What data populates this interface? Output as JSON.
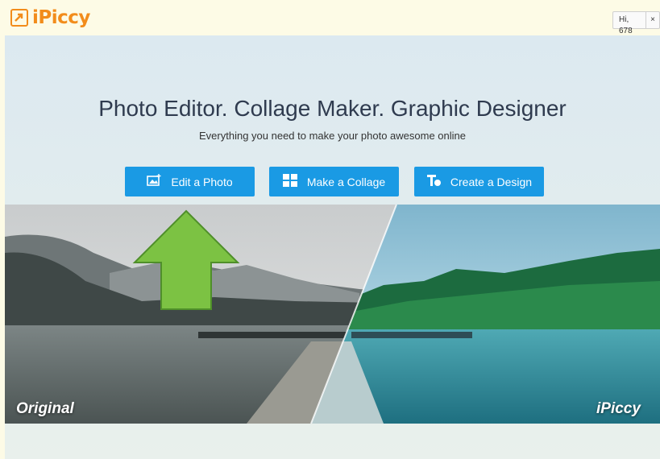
{
  "app": {
    "logo_text": "iPiccy",
    "brand_color": "#f28c1b",
    "accent_color": "#1a9ae4"
  },
  "header": {
    "greeting": "Hi, 678",
    "close_glyph": "×"
  },
  "hero": {
    "title": "Photo Editor. Collage Maker. Graphic Designer",
    "subtitle": "Everything you need to make your photo awesome online"
  },
  "actions": {
    "edit_photo": {
      "label": "Edit a Photo",
      "icon": "photo-edit-icon"
    },
    "make_collage": {
      "label": "Make a Collage",
      "icon": "collage-icon"
    },
    "create_design": {
      "label": "Create a Design",
      "icon": "design-icon"
    }
  },
  "comparison": {
    "left_label": "Original",
    "right_label": "iPiccy"
  },
  "annotation": {
    "arrow_color": "#7cc243",
    "arrow_icon": "up-arrow-icon"
  }
}
